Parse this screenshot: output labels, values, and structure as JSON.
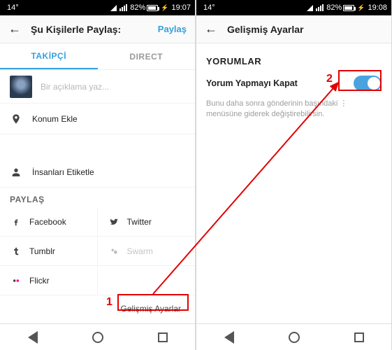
{
  "left": {
    "status": {
      "temp": "14°",
      "battery": "82%",
      "time": "19:07"
    },
    "header": {
      "title": "Şu Kişilerle Paylaş:",
      "action": "Paylaş"
    },
    "tabs": {
      "active": "TAKİPÇİ",
      "other": "DIRECT"
    },
    "caption_placeholder": "Bir açıklama yaz...",
    "location_label": "Konum Ekle",
    "tag_label": "İnsanları Etiketle",
    "share_section": "PAYLAŞ",
    "share": {
      "facebook": "Facebook",
      "twitter": "Twitter",
      "tumblr": "Tumblr",
      "swarm": "Swarm",
      "flickr": "Flickr"
    },
    "advanced": "Gelişmiş Ayarlar"
  },
  "right": {
    "status": {
      "temp": "14°",
      "battery": "82%",
      "time": "19:08"
    },
    "header": {
      "title": "Gelişmiş Ayarlar"
    },
    "section": "YORUMLAR",
    "toggle_label": "Yorum Yapmayı Kapat",
    "hint": "Bunu daha sonra gönderinin başındaki ⋮ menüsüne giderek değiştirebilirsin."
  },
  "anno": {
    "one": "1",
    "two": "2"
  }
}
